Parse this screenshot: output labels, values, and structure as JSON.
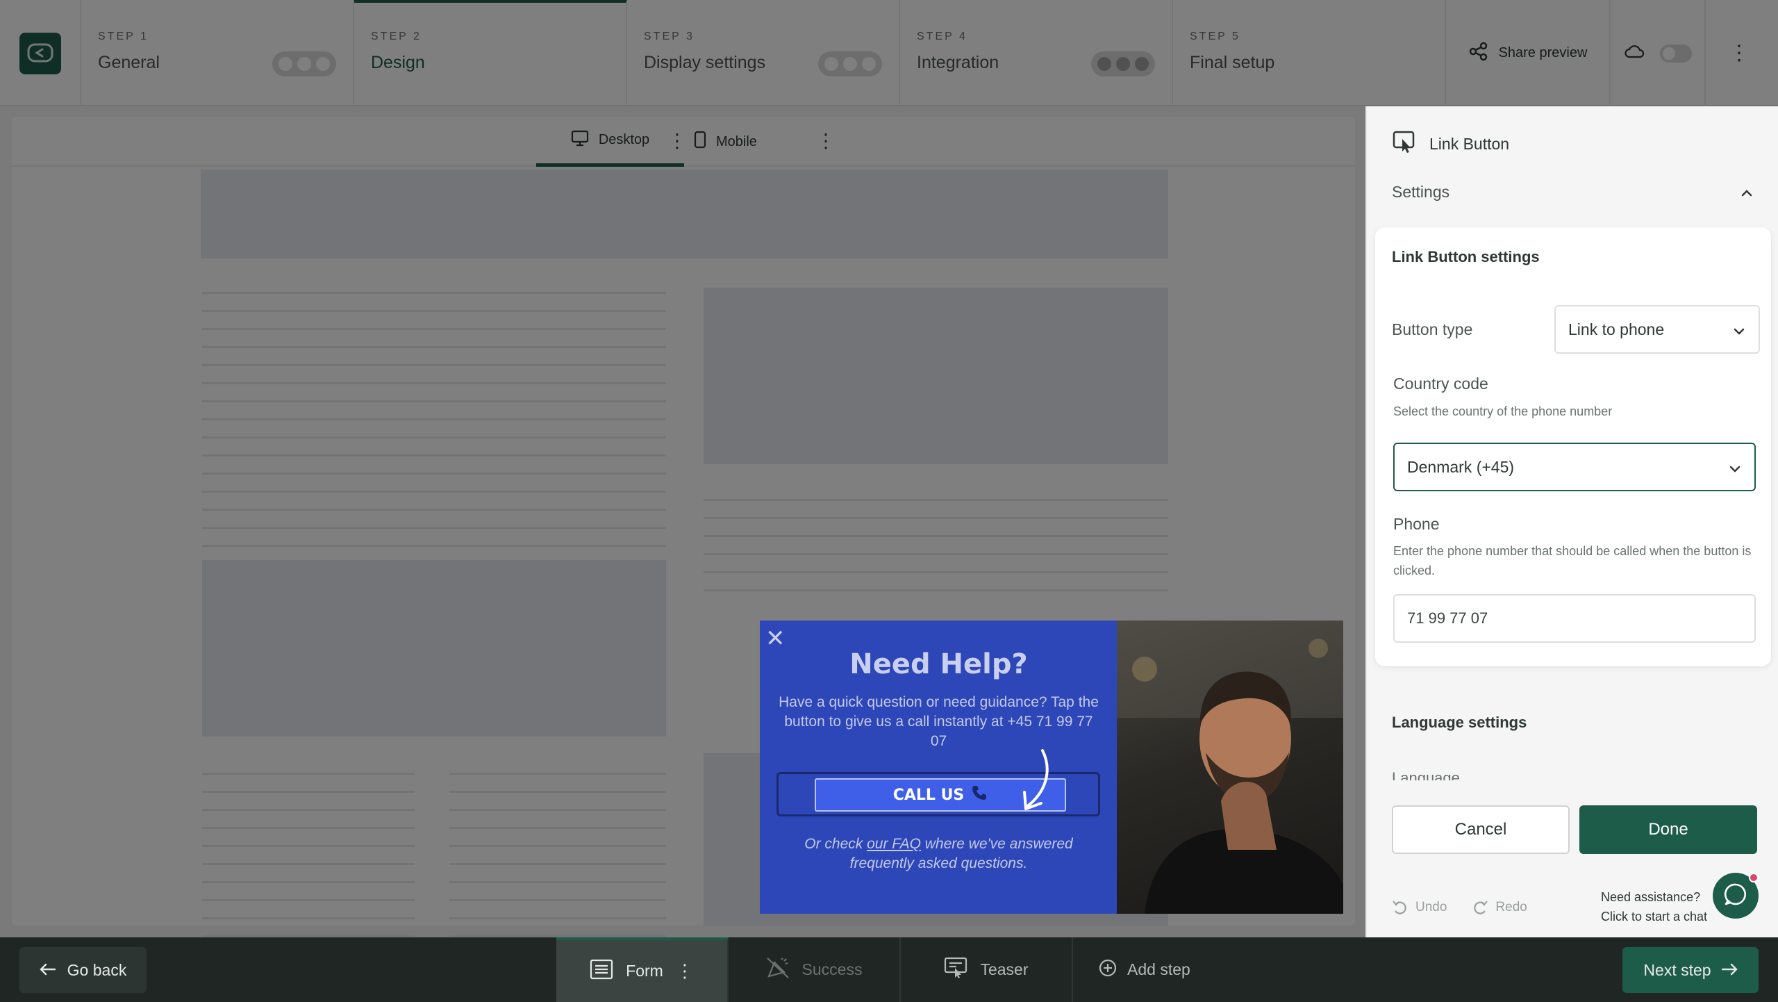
{
  "steps": [
    {
      "num": "STEP 1",
      "name": "General"
    },
    {
      "num": "STEP 2",
      "name": "Design"
    },
    {
      "num": "STEP 3",
      "name": "Display settings"
    },
    {
      "num": "STEP 4",
      "name": "Integration"
    },
    {
      "num": "STEP 5",
      "name": "Final setup"
    }
  ],
  "topbar": {
    "share_label": "Share preview"
  },
  "canvas": {
    "tab_desktop": "Desktop",
    "tab_mobile": "Mobile"
  },
  "popup": {
    "title": "Need Help?",
    "body": "Have a quick question or need guidance? Tap the button to give us a call instantly at +45 71 99 77 07",
    "cta": "CALL US",
    "foot_pre": "Or check ",
    "foot_link": "our FAQ",
    "foot_post": " where we've answered frequently asked questions."
  },
  "panel": {
    "header": "Link Button",
    "settings_label": "Settings",
    "card_title": "Link Button settings",
    "button_type_label": "Button type",
    "button_type_value": "Link to phone",
    "country_label": "Country code",
    "country_hint": "Select the country of the phone number",
    "country_value": "Denmark (+45)",
    "phone_label": "Phone",
    "phone_hint": "Enter the phone number that should be called when the button is clicked.",
    "phone_value": "71 99 77 07",
    "language_title": "Language settings",
    "language_sub": "Language",
    "cancel": "Cancel",
    "done": "Done",
    "undo": "Undo",
    "redo": "Redo",
    "assist_title": "Need assistance?",
    "assist_sub": "Click to start a chat"
  },
  "bottom": {
    "go_back": "Go back",
    "tabs": [
      "Form",
      "Success",
      "Teaser",
      "Add step"
    ],
    "next": "Next step"
  },
  "colors": {
    "brand": "#1e5c4a",
    "popup_bg": "#2e47b8",
    "cta": "#3f5fe8"
  }
}
